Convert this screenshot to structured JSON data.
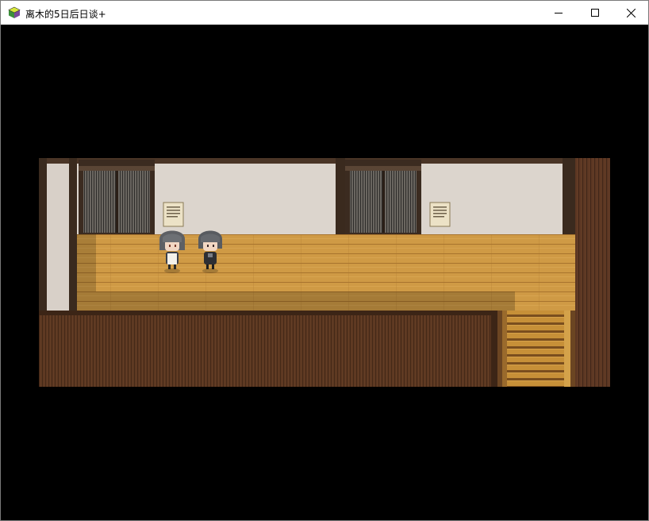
{
  "window": {
    "title": "离木的5日后日谈+",
    "controls": {
      "minimize": "minimize",
      "maximize": "maximize",
      "close": "close"
    }
  },
  "scene": {
    "notices": [
      "notice-1",
      "notice-2"
    ],
    "characters": [
      "girl-white-apron",
      "girl-dark-dress"
    ]
  }
}
